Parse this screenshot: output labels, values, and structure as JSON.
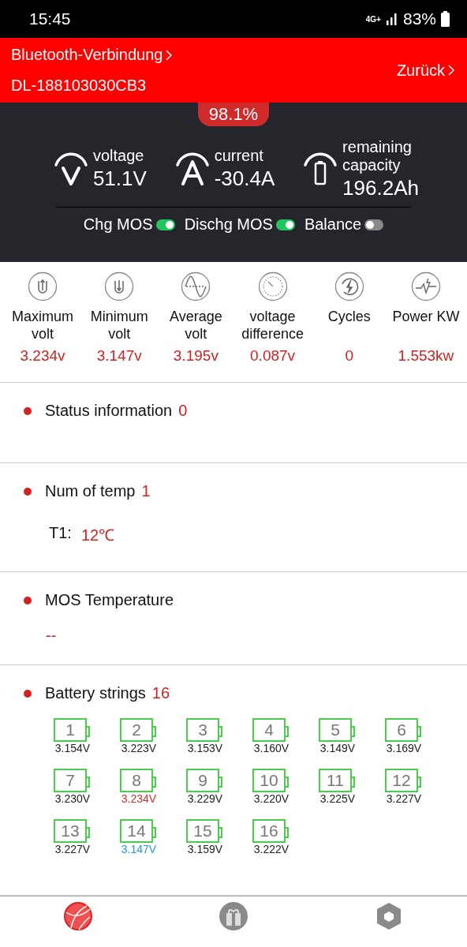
{
  "status_bar": {
    "time": "15:45",
    "network": "4G+",
    "battery": "83%"
  },
  "header": {
    "title": "Bluetooth-Verbindung",
    "device": "DL-188103030CB3",
    "back": "Zurück"
  },
  "summary": {
    "soc": "98.1%",
    "gauges": [
      {
        "kind": "voltage",
        "label": "voltage",
        "value": "51.1V"
      },
      {
        "kind": "current",
        "label": "current",
        "value": "-30.4A"
      },
      {
        "kind": "capacity",
        "label": "remaining capacity",
        "value": "196.2Ah"
      }
    ],
    "switches": [
      {
        "label": "Chg MOS",
        "on": true
      },
      {
        "label": "Dischg MOS",
        "on": true
      },
      {
        "label": "Balance",
        "on": false
      }
    ]
  },
  "metrics": [
    {
      "kind": "max",
      "label": "Maximum volt",
      "value": "3.234v"
    },
    {
      "kind": "min",
      "label": "Minimum volt",
      "value": "3.147v"
    },
    {
      "kind": "avg",
      "label": "Average volt",
      "value": "3.195v"
    },
    {
      "kind": "diff",
      "label": "voltage difference",
      "value": "0.087v"
    },
    {
      "kind": "cycles",
      "label": "Cycles",
      "value": "0"
    },
    {
      "kind": "power",
      "label": "Power KW",
      "value": "1.553kw"
    }
  ],
  "status_info": {
    "title": "Status information",
    "count": "0"
  },
  "temperatures": {
    "title": "Num of temp",
    "count": "1",
    "items": [
      {
        "label": "T1:",
        "value": "12℃"
      }
    ]
  },
  "mos_temperature": {
    "title": "MOS Temperature",
    "value": "--"
  },
  "strings": {
    "title": "Battery strings",
    "count": "16",
    "cells": [
      {
        "index": "1",
        "voltage": "3.154V",
        "color": "#222222"
      },
      {
        "index": "2",
        "voltage": "3.223V",
        "color": "#222222"
      },
      {
        "index": "3",
        "voltage": "3.153V",
        "color": "#222222"
      },
      {
        "index": "4",
        "voltage": "3.160V",
        "color": "#222222"
      },
      {
        "index": "5",
        "voltage": "3.149V",
        "color": "#222222"
      },
      {
        "index": "6",
        "voltage": "3.169V",
        "color": "#222222"
      },
      {
        "index": "7",
        "voltage": "3.230V",
        "color": "#222222"
      },
      {
        "index": "8",
        "voltage": "3.234V",
        "color": "#d32f2f"
      },
      {
        "index": "9",
        "voltage": "3.229V",
        "color": "#222222"
      },
      {
        "index": "10",
        "voltage": "3.220V",
        "color": "#222222"
      },
      {
        "index": "11",
        "voltage": "3.225V",
        "color": "#222222"
      },
      {
        "index": "12",
        "voltage": "3.227V",
        "color": "#222222"
      },
      {
        "index": "13",
        "voltage": "3.227V",
        "color": "#222222"
      },
      {
        "index": "14",
        "voltage": "3.147V",
        "color": "#1e9be0"
      },
      {
        "index": "15",
        "voltage": "3.159V",
        "color": "#222222"
      },
      {
        "index": "16",
        "voltage": "3.222V",
        "color": "#222222"
      }
    ]
  },
  "nav": [
    {
      "kind": "globe",
      "selected": true
    },
    {
      "kind": "gift",
      "selected": false
    },
    {
      "kind": "hex",
      "selected": false
    }
  ]
}
